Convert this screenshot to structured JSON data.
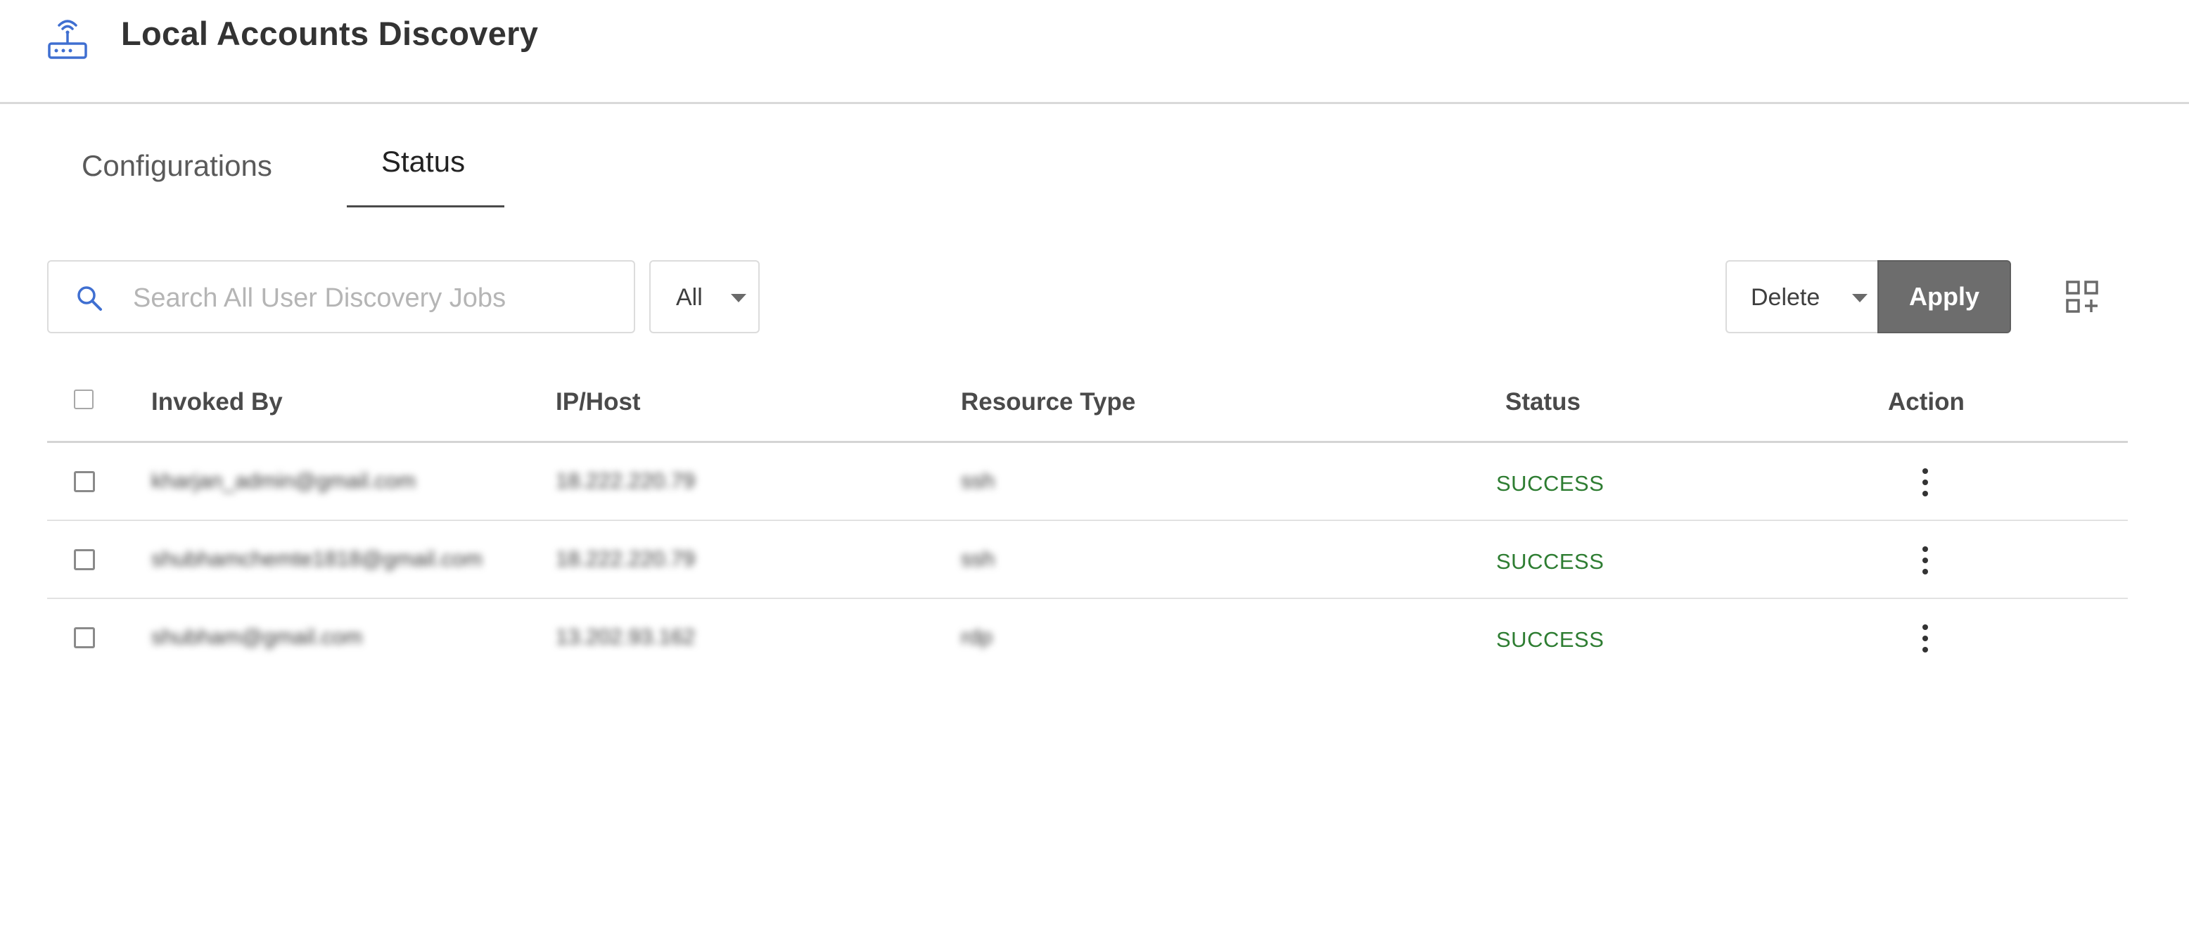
{
  "header": {
    "title": "Local Accounts Discovery",
    "icon": "router-wifi-icon"
  },
  "tabs": [
    {
      "label": "Configurations",
      "active": false
    },
    {
      "label": "Status",
      "active": true
    }
  ],
  "toolbar": {
    "search_placeholder": "Search All User Discovery Jobs",
    "search_value": "",
    "filter_value": "All",
    "bulk_action_value": "Delete",
    "apply_label": "Apply"
  },
  "table": {
    "columns": [
      "Invoked By",
      "IP/Host",
      "Resource Type",
      "Status",
      "Action"
    ],
    "rows": [
      {
        "invoked_by": "kharjan_admin@gmail.com",
        "ip_host": "18.222.220.79",
        "resource_type": "ssh",
        "status": "SUCCESS"
      },
      {
        "invoked_by": "shubhamchemte1818@gmail.com",
        "ip_host": "18.222.220.79",
        "resource_type": "ssh",
        "status": "SUCCESS"
      },
      {
        "invoked_by": "shubham@gmail.com",
        "ip_host": "13.202.93.162",
        "resource_type": "rdp",
        "status": "SUCCESS"
      }
    ]
  },
  "colors": {
    "success": "#2e7d32",
    "apply_bg": "#6d6d6d",
    "accent_icon": "#3f6fd1"
  }
}
